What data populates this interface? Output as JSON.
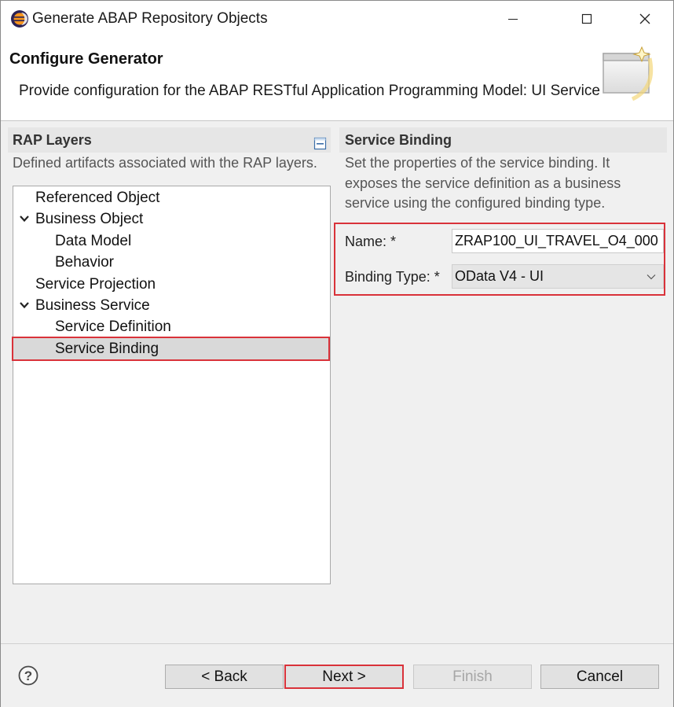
{
  "window": {
    "title": "Generate ABAP Repository Objects",
    "controls": [
      "minimize-icon",
      "maximize-icon",
      "close-icon"
    ]
  },
  "header": {
    "title": "Configure Generator",
    "description": "Provide configuration for the ABAP RESTful Application Programming Model: UI Service"
  },
  "left_panel": {
    "heading": "RAP Layers",
    "description": "Defined artifacts associated with the RAP layers.",
    "tree": [
      {
        "label": "Referenced Object",
        "level": 0,
        "expandable": false
      },
      {
        "label": "Business Object",
        "level": 0,
        "expandable": true,
        "expanded": true
      },
      {
        "label": "Data Model",
        "level": 1,
        "expandable": false
      },
      {
        "label": "Behavior",
        "level": 1,
        "expandable": false
      },
      {
        "label": "Service Projection",
        "level": 0,
        "expandable": false
      },
      {
        "label": "Business Service",
        "level": 0,
        "expandable": true,
        "expanded": true
      },
      {
        "label": "Service Definition",
        "level": 1,
        "expandable": false
      },
      {
        "label": "Service Binding",
        "level": 1,
        "expandable": false,
        "selected": true
      }
    ]
  },
  "right_panel": {
    "heading": "Service Binding",
    "description": "Set the properties of the service binding. It exposes the service definition as a business service using the configured binding type.",
    "name_label": "Name: *",
    "name_value": "ZRAP100_UI_TRAVEL_O4_000",
    "binding_type_label": "Binding Type: *",
    "binding_type_value": "OData V4 - UI"
  },
  "footer": {
    "back_label": "< Back",
    "next_label": "Next >",
    "finish_label": "Finish",
    "cancel_label": "Cancel",
    "finish_enabled": false
  },
  "colors": {
    "highlight": "#d9323a",
    "panel_bg": "#f0f0f0",
    "selection": "#d9d9d9"
  }
}
